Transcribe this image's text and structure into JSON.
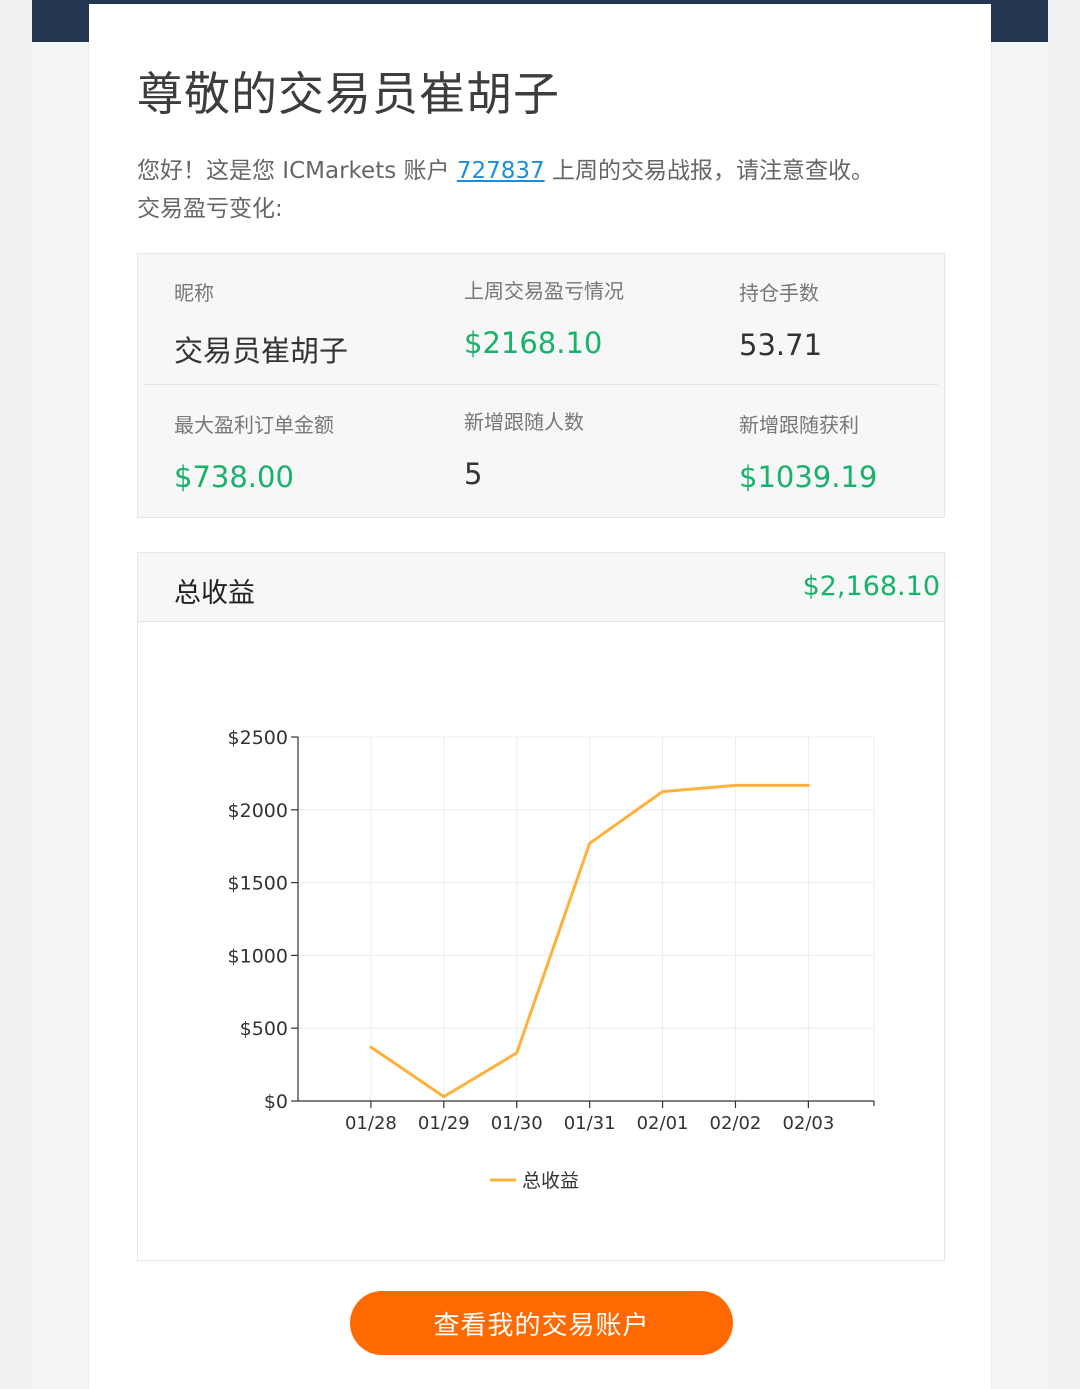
{
  "greeting": {
    "title": "尊敬的交易员崔胡子",
    "intro_prefix": "您好！这是您 ICMarkets 账户 ",
    "account_number": "727837",
    "intro_suffix": " 上周的交易战报，请注意查收。",
    "pnl_change_label": "交易盈亏变化:"
  },
  "stats": [
    {
      "label": "昵称",
      "value": "交易员崔胡子",
      "highlight": false
    },
    {
      "label": "上周交易盈亏情况",
      "value": "$2168.10",
      "highlight": true
    },
    {
      "label": "持仓手数",
      "value": "53.71",
      "highlight": false
    },
    {
      "label": "最大盈利订单金额",
      "value": "$738.00",
      "highlight": true
    },
    {
      "label": "新增跟随人数",
      "value": "5",
      "highlight": false
    },
    {
      "label": "新增跟随获利",
      "value": "$1039.19",
      "highlight": true
    }
  ],
  "total_panel": {
    "title": "总收益",
    "value": "$2,168.10"
  },
  "chart_data": {
    "type": "line",
    "categories": [
      "01/28",
      "01/29",
      "01/30",
      "01/31",
      "02/01",
      "02/02",
      "02/03"
    ],
    "y_tick_labels": [
      "$0",
      "$500",
      "$1000",
      "$1500",
      "$2000",
      "$2500"
    ],
    "y_ticks": [
      0,
      500,
      1000,
      1500,
      2000,
      2500
    ],
    "ylim": [
      0,
      2500
    ],
    "grid": true,
    "legend": "bottom-center",
    "series": [
      {
        "name": "总收益",
        "color": "#ffb13b",
        "values": [
          370,
          30,
          330,
          1770,
          2125,
          2168,
          2168
        ]
      }
    ]
  },
  "cta": {
    "label": "查看我的交易账户"
  },
  "colors": {
    "accent_green": "#18b26b",
    "button_orange": "#ff6a00",
    "link_blue": "#1a8fd9",
    "line_orange": "#ffb13b",
    "banner_navy": "#22364f"
  }
}
